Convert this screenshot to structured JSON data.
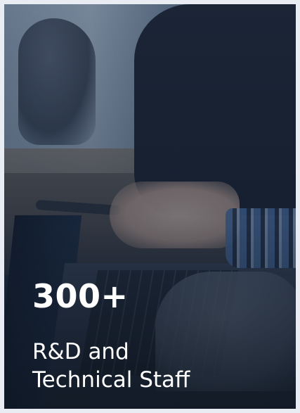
{
  "stat_card": {
    "number": "300+",
    "caption_line1": "R&D and",
    "caption_line2": "Technical Staff"
  },
  "colors": {
    "text": "#ffffff",
    "card_background": "#2b3a4f",
    "page_background": "#e9edf3"
  }
}
